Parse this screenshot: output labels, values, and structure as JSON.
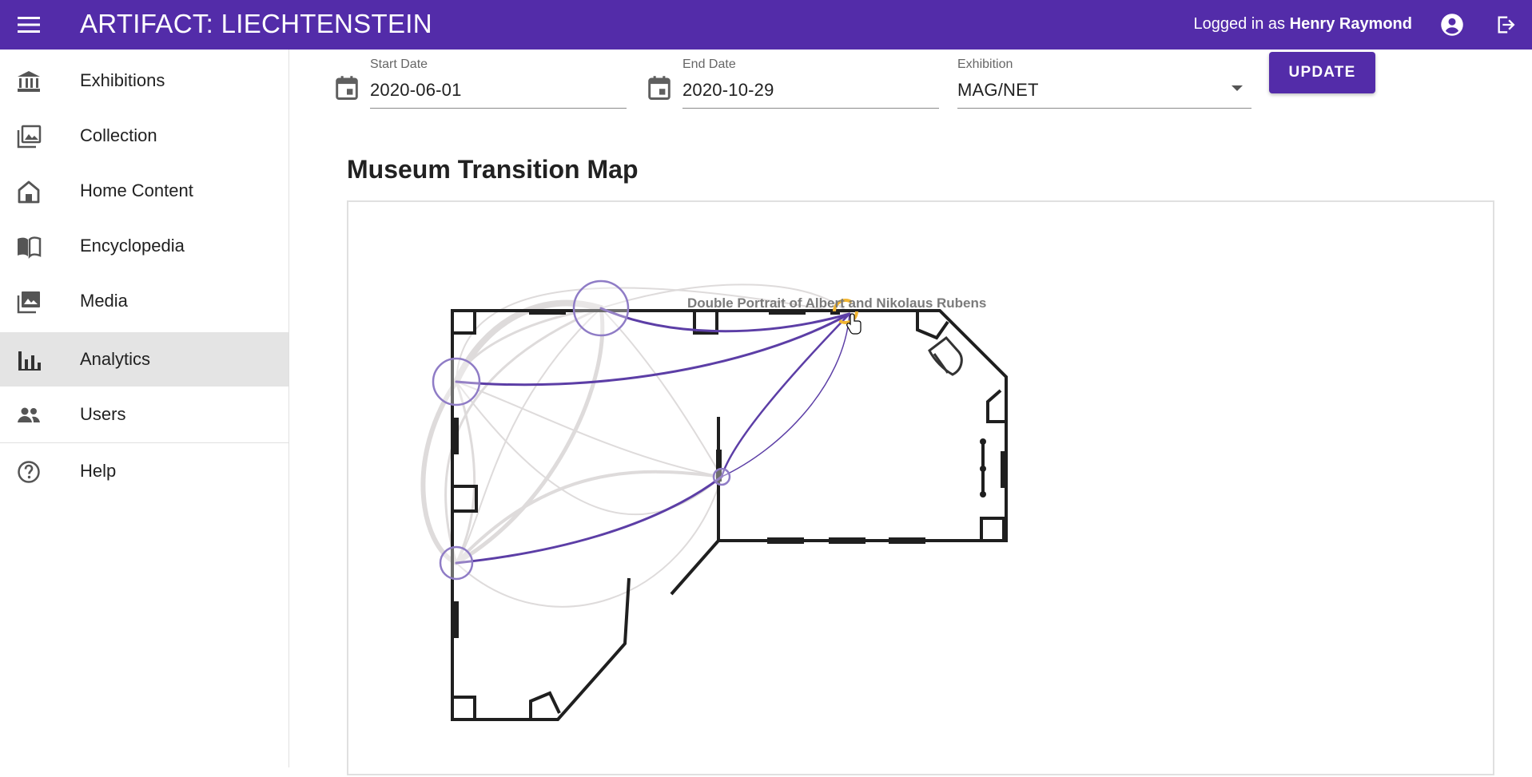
{
  "header": {
    "title": "ARTIFACT: LIECHTENSTEIN",
    "logged_in_prefix": "Logged in as ",
    "user_name": "Henry Raymond",
    "menu_icon": "menu-icon",
    "account_icon": "account-circle-icon",
    "logout_icon": "logout-icon"
  },
  "sidebar": {
    "items": [
      {
        "label": "Exhibitions",
        "icon": "museum-icon"
      },
      {
        "label": "Collection",
        "icon": "photo-library-icon"
      },
      {
        "label": "Home Content",
        "icon": "home-icon"
      },
      {
        "label": "Encyclopedia",
        "icon": "book-icon"
      },
      {
        "label": "Media",
        "icon": "collections-icon"
      },
      {
        "label": "Analytics",
        "icon": "bar-chart-icon",
        "active": true
      },
      {
        "label": "Users",
        "icon": "people-icon"
      },
      {
        "label": "Help",
        "icon": "help-icon"
      }
    ]
  },
  "filters": {
    "start_date": {
      "label": "Start Date",
      "value": "2020-06-01"
    },
    "end_date": {
      "label": "End Date",
      "value": "2020-10-29"
    },
    "exhibition": {
      "label": "Exhibition",
      "value": "MAG/NET"
    },
    "update_label": "UPDATE"
  },
  "map": {
    "title": "Museum Transition Map",
    "hover_label": "Double Portrait of Albert and Nikolaus Rubens",
    "highlight_color": "#5c3ea6",
    "edge_color": "#d9d6d6"
  },
  "colors": {
    "primary": "#532ca9",
    "active_nav": "#e4e4e4"
  }
}
